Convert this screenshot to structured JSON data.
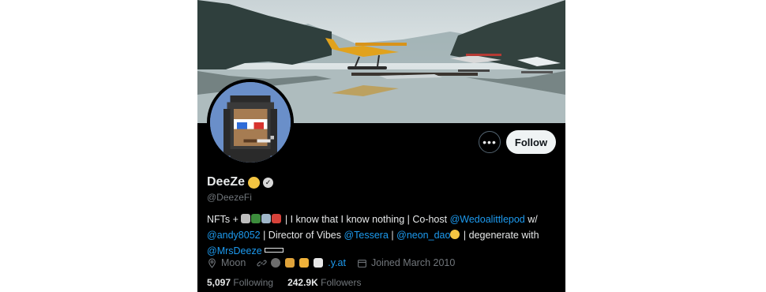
{
  "profile": {
    "display_name": "DeeZe",
    "handle": "@DeezeFi",
    "follow_label": "Follow",
    "more_label": "•••"
  },
  "bio": {
    "part1": "NFTs + ",
    "part2": " | I know that I know nothing | Co-host ",
    "mention1": "@Wedoalittlepod",
    "part3": " w/ ",
    "mention2": "@andy8052",
    "part4": " | Director of Vibes ",
    "mention3": "@Tessera",
    "part5": " | ",
    "mention4": "@neon_dao",
    "part6": " | degenerate with ",
    "mention5": "@MrsDeeze"
  },
  "meta": {
    "location": "Moon",
    "website": ".y.at",
    "joined": "Joined March 2010"
  },
  "stats": {
    "following_count": "5,097",
    "following_label": "Following",
    "followers_count": "242.9K",
    "followers_label": "Followers"
  },
  "colors": {
    "background": "#000000",
    "link": "#1d9bf0",
    "muted": "#71767b",
    "text": "#e7e9ea"
  }
}
